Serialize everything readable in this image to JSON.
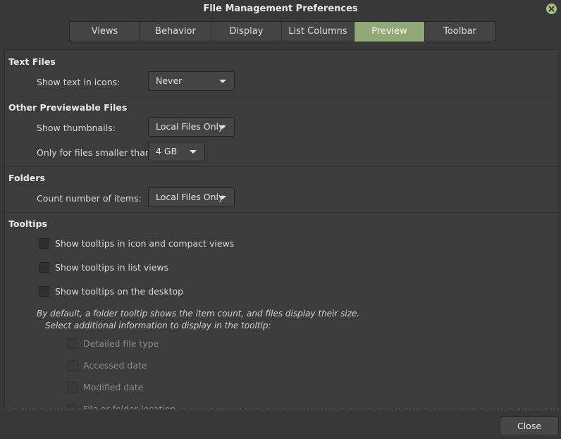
{
  "window": {
    "title": "File Management Preferences"
  },
  "tabs": [
    {
      "label": "Views",
      "active": false
    },
    {
      "label": "Behavior",
      "active": false
    },
    {
      "label": "Display",
      "active": false
    },
    {
      "label": "List Columns",
      "active": false
    },
    {
      "label": "Preview",
      "active": true
    },
    {
      "label": "Toolbar",
      "active": false
    }
  ],
  "text_files": {
    "heading": "Text Files",
    "show_text_label": "Show text in icons:",
    "show_text_value": "Never"
  },
  "other_previewable": {
    "heading": "Other Previewable Files",
    "thumbnails_label": "Show thumbnails:",
    "thumbnails_value": "Local Files Only",
    "size_label": "Only for files smaller than:",
    "size_value": "4 GB"
  },
  "folders": {
    "heading": "Folders",
    "count_label": "Count number of items:",
    "count_value": "Local Files Only"
  },
  "tooltips": {
    "heading": "Tooltips",
    "options": [
      {
        "label": "Show tooltips in icon and compact views",
        "checked": false
      },
      {
        "label": "Show tooltips in list views",
        "checked": false
      },
      {
        "label": "Show tooltips on the desktop",
        "checked": false
      }
    ],
    "note_line1": "By default, a folder tooltip shows the item count, and files display their size.",
    "note_line2": "Select additional information to display in the tooltip:",
    "extra_options": [
      {
        "label": "Detailed file type",
        "checked": false
      },
      {
        "label": "Accessed date",
        "checked": false
      },
      {
        "label": "Modified date",
        "checked": false
      },
      {
        "label": "File or folder location",
        "checked": false
      }
    ]
  },
  "footer": {
    "close_label": "Close"
  },
  "colors": {
    "accent": "#8fa876",
    "window_bg": "#383838",
    "panel_bg": "#3c3c3c"
  }
}
